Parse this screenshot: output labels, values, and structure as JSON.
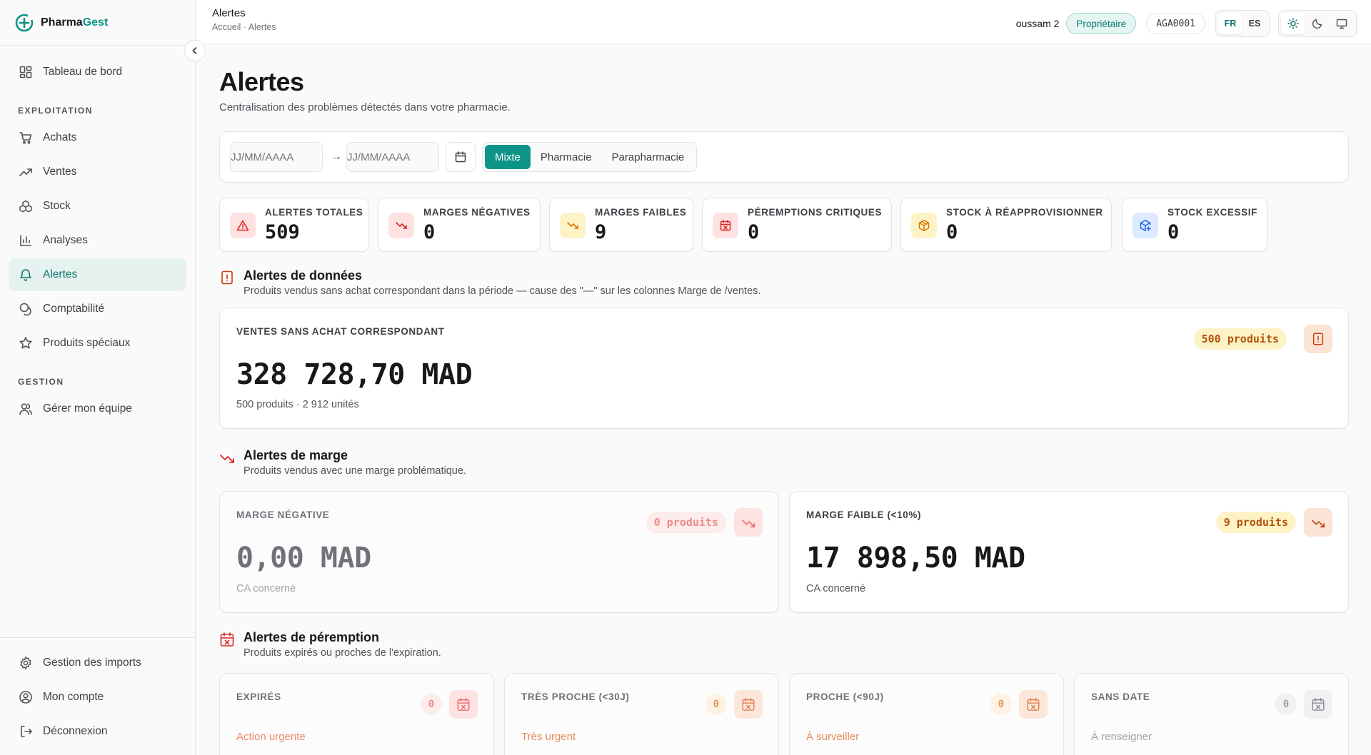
{
  "brand": {
    "name_a": "Pharma",
    "name_b": "Gest"
  },
  "sidebar": {
    "items_top": [
      {
        "label": "Tableau de bord",
        "icon": "dashboard-icon"
      }
    ],
    "section_exploitation": "EXPLOITATION",
    "items_exploitation": [
      {
        "label": "Achats",
        "icon": "cart-icon"
      },
      {
        "label": "Ventes",
        "icon": "trending-up-icon"
      },
      {
        "label": "Stock",
        "icon": "boxes-icon"
      },
      {
        "label": "Analyses",
        "icon": "bar-chart-icon"
      },
      {
        "label": "Alertes",
        "icon": "bell-icon",
        "active": true
      },
      {
        "label": "Comptabilité",
        "icon": "coins-icon"
      },
      {
        "label": "Produits spéciaux",
        "icon": "star-icon"
      }
    ],
    "section_gestion": "GESTION",
    "items_gestion": [
      {
        "label": "Gérer mon équipe",
        "icon": "users-icon"
      }
    ],
    "items_bottom": [
      {
        "label": "Gestion des imports",
        "icon": "gear-icon"
      },
      {
        "label": "Mon compte",
        "icon": "user-circle-icon"
      },
      {
        "label": "Déconnexion",
        "icon": "logout-icon"
      }
    ]
  },
  "topbar": {
    "title": "Alertes",
    "breadcrumb": "Accueil · Alertes",
    "user": "oussam 2",
    "role": "Propriétaire",
    "code": "AGA0001",
    "lang": [
      "FR",
      "ES"
    ],
    "lang_active": "FR",
    "themes": [
      "sun-icon",
      "moon-icon",
      "monitor-icon"
    ]
  },
  "page": {
    "title": "Alertes",
    "subtitle": "Centralisation des problèmes détectés dans votre pharmacie."
  },
  "filters": {
    "date_from_placeholder": "JJ/MM/AAAA",
    "date_to_placeholder": "JJ/MM/AAAA",
    "arrow": "→",
    "types": [
      "Mixte",
      "Pharmacie",
      "Parapharmacie"
    ],
    "active_type": "Mixte"
  },
  "stats": [
    {
      "label": "ALERTES TOTALES",
      "value": "509",
      "icon": "warning-triangle-icon"
    },
    {
      "label": "MARGES NÉGATIVES",
      "value": "0",
      "icon": "trending-down-icon"
    },
    {
      "label": "MARGES FAIBLES",
      "value": "9",
      "icon": "trending-down-icon"
    },
    {
      "label": "PÉREMPTIONS CRITIQUES",
      "value": "0",
      "icon": "calendar-x-icon"
    },
    {
      "label": "STOCK À RÉAPPROVISIONNER",
      "value": "0",
      "icon": "package-icon"
    },
    {
      "label": "STOCK EXCESSIF",
      "value": "0",
      "icon": "package-plus-icon"
    }
  ],
  "data_alerts": {
    "title": "Alertes de données",
    "description": "Produits vendus sans achat correspondant dans la période — cause des \"—\" sur les colonnes Marge de /ventes.",
    "card": {
      "label": "VENTES SANS ACHAT CORRESPONDANT",
      "badge": "500 produits",
      "amount": "328 728,70 MAD",
      "sub": "500 produits · 2   912 unités"
    }
  },
  "margin_alerts": {
    "title": "Alertes de marge",
    "description": "Produits vendus avec une marge problématique.",
    "negative": {
      "label": "MARGE NÉGATIVE",
      "badge": "0 produits",
      "amount": "0,00 MAD",
      "sub": "CA concerné"
    },
    "low": {
      "label": "MARGE FAIBLE (<10%)",
      "badge": "9 produits",
      "amount": "17 898,50 MAD",
      "sub": "CA concerné"
    }
  },
  "expiry_alerts": {
    "title": "Alertes de péremption",
    "description": "Produits expirés ou proches de l'expiration.",
    "cards": [
      {
        "label": "EXPIRÉS",
        "count": "0",
        "hint": "Action urgente"
      },
      {
        "label": "TRÈS PROCHE (<30J)",
        "count": "0",
        "hint": "Très urgent"
      },
      {
        "label": "PROCHE (<90J)",
        "count": "0",
        "hint": "À surveiller"
      },
      {
        "label": "SANS DATE",
        "count": "0",
        "hint": "À renseigner"
      }
    ]
  },
  "colors": {
    "brand": "#0d9488",
    "danger": "#dc2626",
    "warning": "#d97706",
    "orange": "#c2410c",
    "info": "#2563eb"
  }
}
